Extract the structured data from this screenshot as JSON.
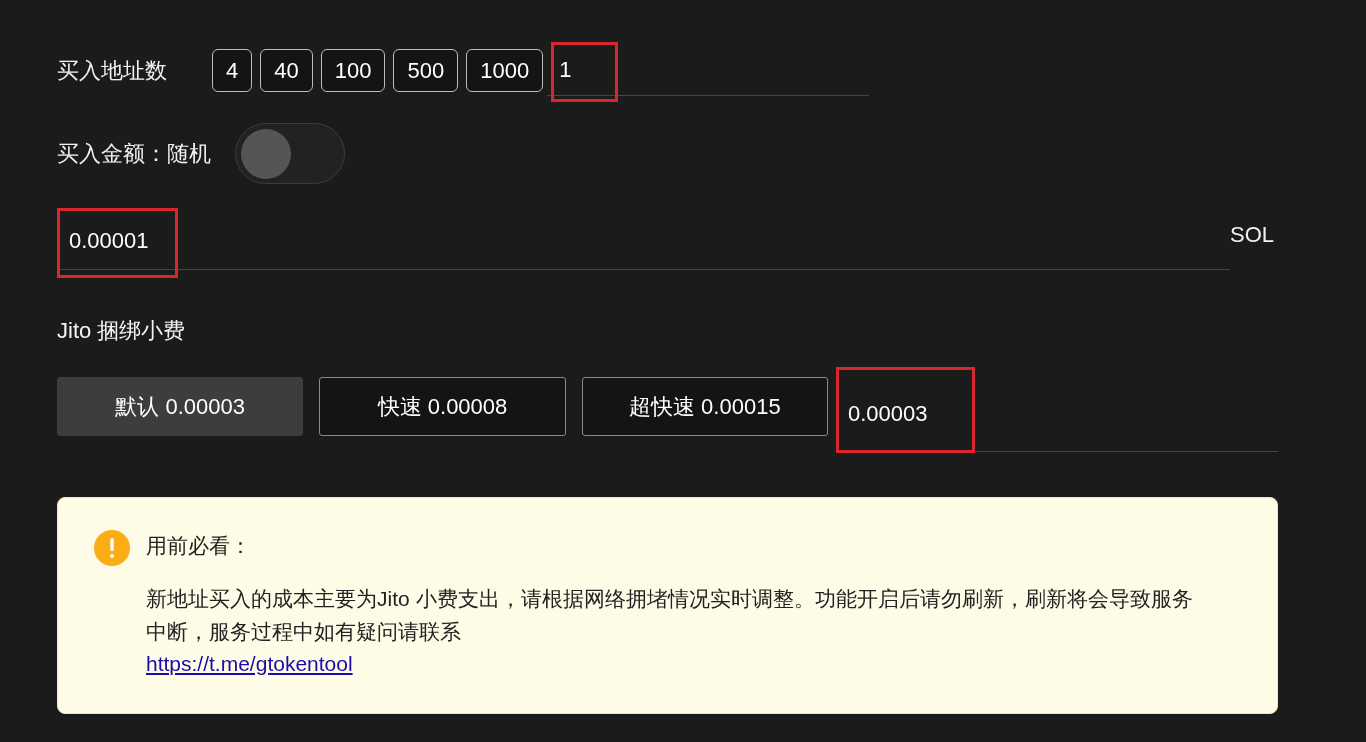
{
  "address_count": {
    "label": "买入地址数",
    "presets": [
      {
        "label": "4"
      },
      {
        "label": "40"
      },
      {
        "label": "100"
      },
      {
        "label": "500"
      },
      {
        "label": "1000"
      }
    ],
    "input": {
      "value": "1",
      "highlighted": true
    }
  },
  "amount": {
    "label": "买入金额：随机",
    "random": false,
    "input": {
      "value": "0.00001",
      "highlighted": true
    },
    "unit": "SOL"
  },
  "jito_tip": {
    "label": "Jito 捆绑小费",
    "options": [
      {
        "label": "默认 0.00003",
        "selected": true
      },
      {
        "label": "快速 0.00008",
        "selected": false
      },
      {
        "label": "超快速 0.00015",
        "selected": false
      }
    ],
    "input": {
      "value": "0.00003",
      "highlighted": true
    }
  },
  "notice": {
    "title": "用前必看：",
    "message": "新地址买入的成本主要为Jito 小费支出，请根据网络拥堵情况实时调整。功能开启后请勿刷新，刷新将会导致服务中断，服务过程中如有疑问请联系",
    "link": "https://t.me/gtokentool"
  }
}
